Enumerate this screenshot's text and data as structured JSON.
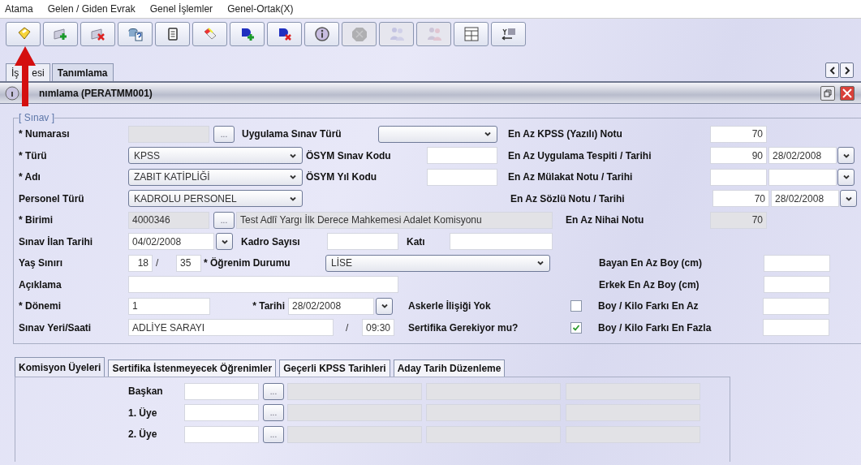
{
  "menu": [
    {
      "label": "Atama"
    },
    {
      "label": "Gelen / Giden Evrak"
    },
    {
      "label": "Genel İşlemler"
    },
    {
      "label": "Genel-Ortak(X)"
    }
  ],
  "toolbar": [
    {
      "disabled": false
    },
    {
      "disabled": false
    },
    {
      "disabled": false
    },
    {
      "disabled": false
    },
    {
      "disabled": false
    },
    {
      "disabled": false
    },
    {
      "disabled": false
    },
    {
      "disabled": false
    },
    {
      "disabled": false
    },
    {
      "disabled": true
    },
    {
      "disabled": true
    },
    {
      "disabled": true
    },
    {
      "disabled": false
    },
    {
      "disabled": false
    }
  ],
  "tabs": [
    {
      "label": "İş",
      "label_end": "esi",
      "selected": false
    },
    {
      "label": "Tanımlama",
      "selected": true
    }
  ],
  "window": {
    "title": "nımlama (PERATMM001)"
  },
  "form": {
    "legend": "[ Sınav ]",
    "numarasi": {
      "label": "* Numarası",
      "button": "..."
    },
    "uygulama_sinav_turu": {
      "label": "Uygulama Sınav Türü"
    },
    "en_az_kpss": {
      "label": "En Az KPSS (Yazılı) Notu",
      "value": "70"
    },
    "turu": {
      "label": "* Türü",
      "value": "KPSS"
    },
    "osym_sinav_kodu": {
      "label": "ÖSYM Sınav Kodu"
    },
    "uygulama_tespiti": {
      "label": "En Az Uygulama Tespiti / Tarihi",
      "value": "90",
      "date": "28/02/2008"
    },
    "adi": {
      "label": "* Adı",
      "value": "ZABIT KATİPLİĞİ"
    },
    "osym_yil_kodu": {
      "label": "ÖSYM Yıl Kodu"
    },
    "mulakat": {
      "label": "En Az Mülakat Notu / Tarihi"
    },
    "personel_turu": {
      "label": "Personel Türü",
      "value": "KADROLU PERSONEL"
    },
    "sozlu": {
      "label": "En Az Sözlü Notu / Tarihi",
      "value": "70",
      "date": "28/02/2008"
    },
    "birimi": {
      "label": "* Birimi",
      "code": "4000346",
      "button": "...",
      "name": "Test Adlî Yargı İlk Derece Mahkemesi Adalet Komisyonu"
    },
    "nihai": {
      "label": "En Az Nihai Notu",
      "value": "70"
    },
    "ilan_tarihi": {
      "label": "Sınav İlan Tarihi",
      "value": "04/02/2008"
    },
    "kadro_sayisi": {
      "label": "Kadro Sayısı"
    },
    "kati": {
      "label": "Katı"
    },
    "yas_siniri": {
      "label": "Yaş Sınırı",
      "min": "18",
      "separator": "/",
      "max": "35"
    },
    "ogrenim": {
      "label": "* Öğrenim Durumu",
      "value": "LİSE"
    },
    "bayan_boy": {
      "label": "Bayan En Az Boy (cm)"
    },
    "aciklama": {
      "label": "Açıklama"
    },
    "erkek_boy": {
      "label": "Erkek En Az Boy (cm)"
    },
    "donemi": {
      "label": "* Dönemi",
      "value": "1"
    },
    "tarihi": {
      "label": "* Tarihi",
      "value": "28/02/2008"
    },
    "askerlik": {
      "label": "Askerle İlişiği Yok",
      "checked": false
    },
    "boy_kilo_az": {
      "label": "Boy / Kilo Farkı En Az"
    },
    "yer_saat": {
      "label": "Sınav Yeri/Saati",
      "place": "ADLİYE SARAYI",
      "separator": "/",
      "time": "09:30"
    },
    "sertifika": {
      "label": "Sertifika Gerekiyor mu?",
      "checked": true
    },
    "boy_kilo_fazla": {
      "label": "Boy / Kilo Farkı En Fazla"
    }
  },
  "subtabs": [
    {
      "label": "Komisyon Üyeleri",
      "selected": true
    },
    {
      "label": "Sertifika İstenmeyecek Öğrenimler",
      "selected": false
    },
    {
      "label": "Geçerli KPSS Tarihleri",
      "selected": false
    },
    {
      "label": "Aday Tarih Düzenleme",
      "selected": false
    }
  ],
  "members": [
    {
      "label": "Başkan",
      "button": "..."
    },
    {
      "label": "1. Üye",
      "button": "..."
    },
    {
      "label": "2. Üye",
      "button": "..."
    }
  ]
}
